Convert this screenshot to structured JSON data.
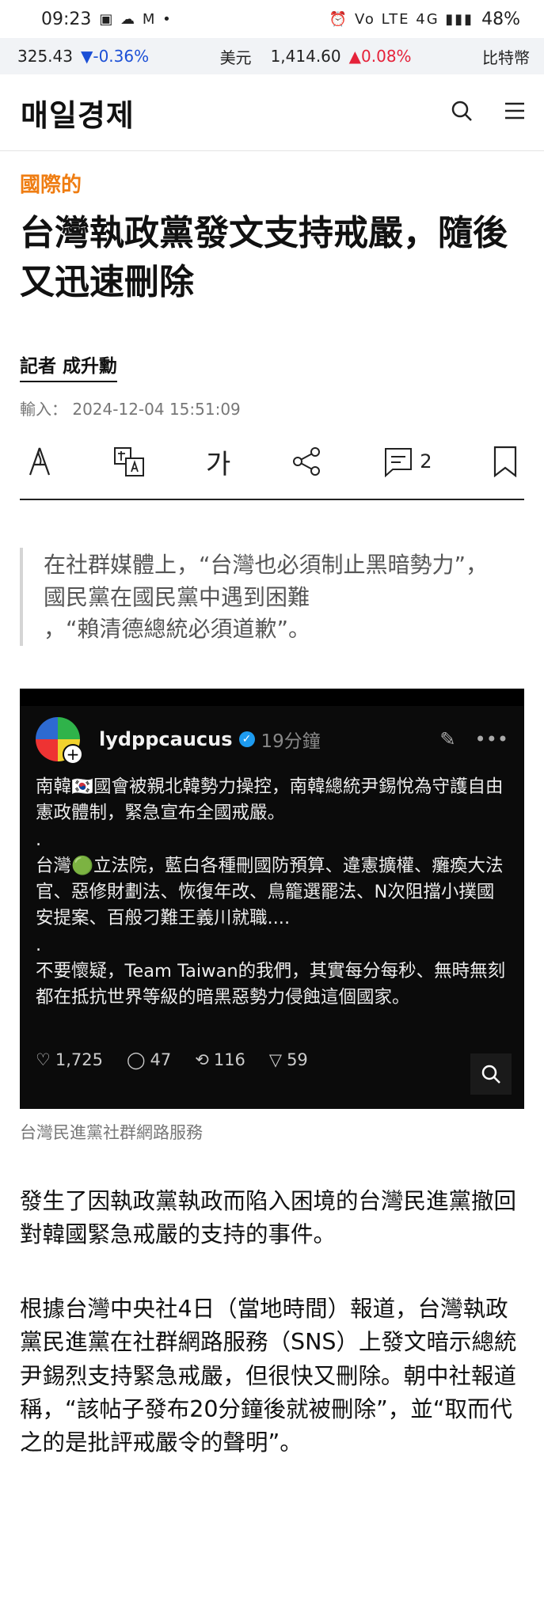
{
  "status": {
    "time": "09:23",
    "battery": "48%",
    "icons": "▣ ☁ M •",
    "right_icons": "⏰ Vo LTE 4G ▮▮▮"
  },
  "ticker": {
    "left_value": "325.43",
    "left_change": "▼-0.36%",
    "currency_label": "美元",
    "currency_value": "1,414.60",
    "currency_change": "▲0.08%",
    "right_label": "比特幣"
  },
  "header": {
    "logo": "매일경제"
  },
  "article": {
    "category": "國際的",
    "title": "台灣執政黨發文支持戒嚴，隨後又迅速刪除",
    "reporter": "記者 成升勳",
    "date": "輸入： 2024-12-04 15:51:09",
    "toolbar": {
      "font_label": "가",
      "comment_count": "2"
    },
    "quote": [
      "在社群媒體上，“台灣也必須制止黑暗勢力”，",
      "國民黨在國民黨中遇到困難",
      "，“賴清德總統必須道歉”。"
    ],
    "post": {
      "username": "lydppcaucus",
      "time": "19分鐘",
      "para1": "南韓🇰🇷國會被親北韓勢力操控，南韓總統尹錫悅為守護自由憲政體制，緊急宣布全國戒嚴。",
      "dot1": ".",
      "para2": "台灣🟢立法院，藍白各種刪國防預算、違憲擴權、癱瘓大法官、惡修財劃法、恢復年改、鳥籠選罷法、N次阻擋小撲國安提案、百般刁難王義川就職....",
      "dot2": ".",
      "para3": "不要懷疑，Team Taiwan的我們，其實每分每秒、無時無刻都在抵抗世界等級的暗黑惡勢力侵蝕這個國家。",
      "likes": "1,725",
      "comments": "47",
      "reposts": "116",
      "shares": "59"
    },
    "caption": "台灣民進黨社群網路服務",
    "paragraphs": [
      "發生了因執政黨執政而陷入困境的台灣民進黨撤回對韓國緊急戒嚴的支持的事件。",
      "根據台灣中央社4日（當地時間）報道，台灣執政黨民進黨在社群網路服務（SNS）上發文暗示總統尹錫烈支持緊急戒嚴，但很快又刪除。朝中社報道稱，“該帖子發布20分鐘後就被刪除”，並“取而代之的是批評戒嚴令的聲明”。"
    ]
  },
  "colors": {
    "accent": "#ef7d12",
    "down": "#1b4fd6",
    "up": "#e5223a"
  }
}
